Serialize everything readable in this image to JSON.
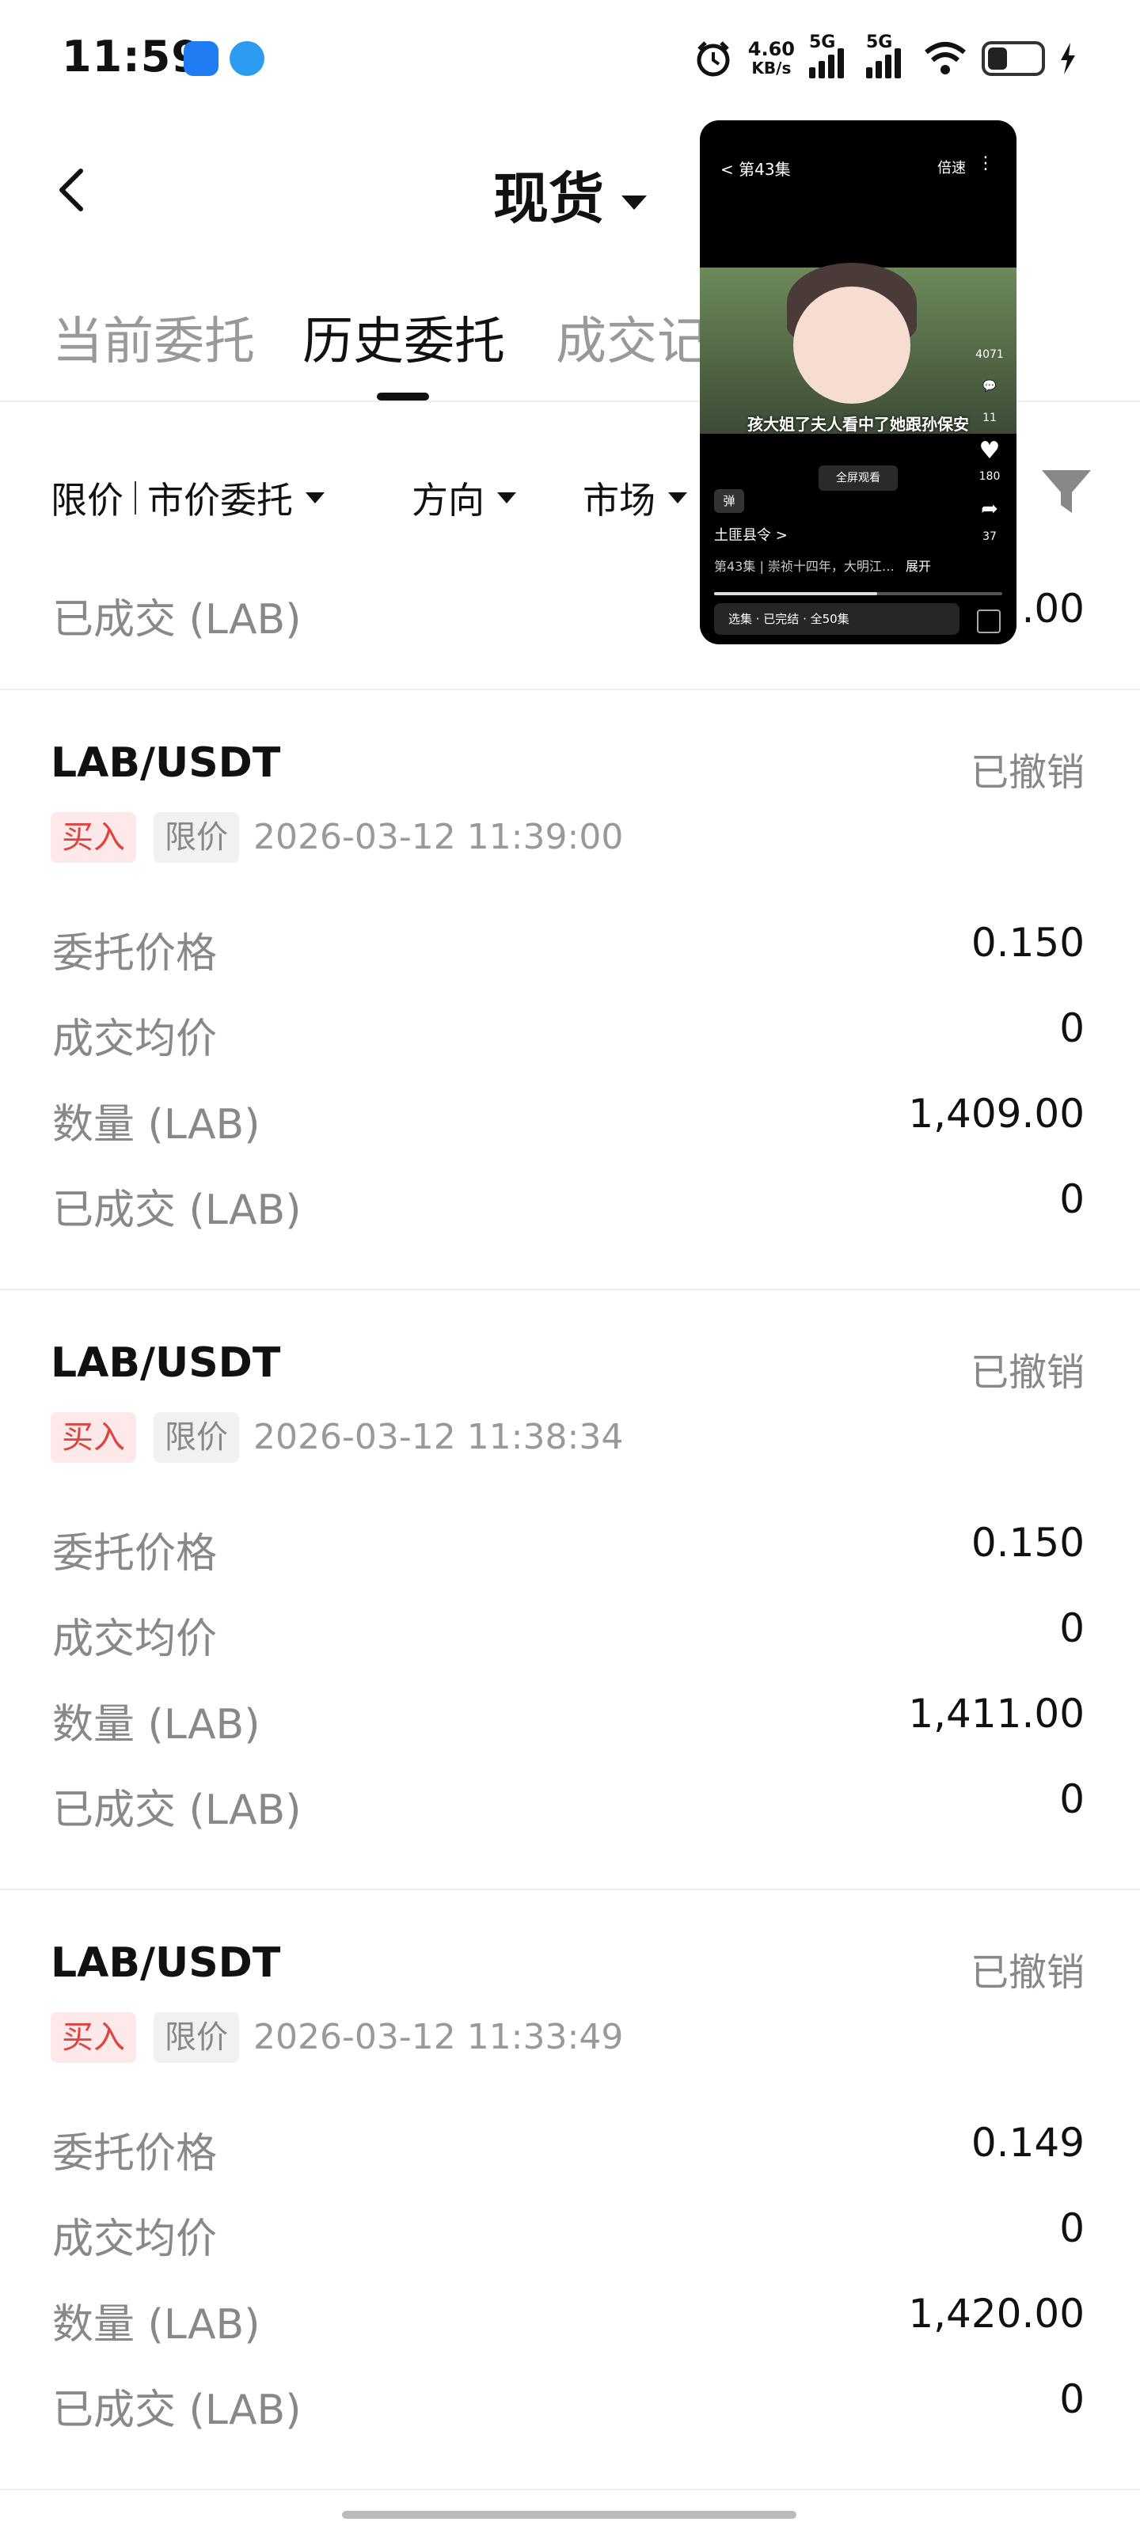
{
  "status_bar": {
    "time": "11:59",
    "net_speed_value": "4.60",
    "net_speed_unit": "KB/s",
    "signal1_label": "5G",
    "signal2_label": "5G",
    "battery_level": 0.25
  },
  "header": {
    "title": "现货"
  },
  "tabs": [
    "当前委托",
    "历史委托",
    "成交记"
  ],
  "filters": {
    "order_type_1": "限价",
    "order_type_2": "市价委托",
    "direction": "方向",
    "market": "市场"
  },
  "partial_order": {
    "filled_label": "已成交 (LAB)",
    "filled_value": ".00"
  },
  "labels": {
    "price": "委托价格",
    "avg": "成交均价",
    "qty": "数量 (LAB)",
    "filled": "已成交 (LAB)"
  },
  "orders": [
    {
      "pair": "LAB/USDT",
      "status": "已撤销",
      "side": "买入",
      "type": "限价",
      "time": "2026-03-12 11:39:00",
      "price": "0.150",
      "avg": "0",
      "qty": "1,409.00",
      "filled": "0"
    },
    {
      "pair": "LAB/USDT",
      "status": "已撤销",
      "side": "买入",
      "type": "限价",
      "time": "2026-03-12 11:38:34",
      "price": "0.150",
      "avg": "0",
      "qty": "1,411.00",
      "filled": "0"
    },
    {
      "pair": "LAB/USDT",
      "status": "已撤销",
      "side": "买入",
      "type": "限价",
      "time": "2026-03-12 11:33:49",
      "price": "0.149",
      "avg": "0",
      "qty": "1,420.00",
      "filled": "0"
    }
  ],
  "pip": {
    "episode": "第43集",
    "speed": "倍速",
    "subtitle": "孩大姐了夫人看中了她跟孙保安",
    "fullscreen": "全屏观看",
    "danmu": "弹",
    "likes": "180",
    "comments": "11",
    "shares": "37",
    "views": "4071",
    "author": "土匪县令 >",
    "desc": "第43集 | 崇祯十四年，大明江…",
    "expand": "展开",
    "collection": "选集 · 已完结 · 全50集"
  }
}
